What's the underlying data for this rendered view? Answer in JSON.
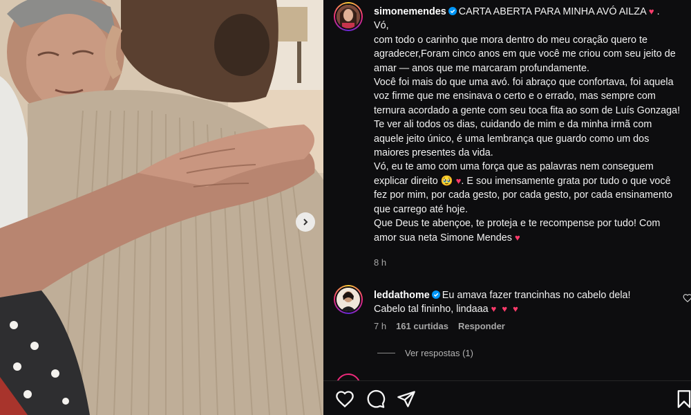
{
  "photo": {
    "alt_subject": "photo",
    "next_icon": "chevron-right-icon"
  },
  "post": {
    "username": "simonemendes",
    "verified": true,
    "caption": {
      "title": "CARTA ABERTA PARA MINHA AVÓ AILZA",
      "title_end": ".",
      "p1": "Vó,",
      "p2": "com todo o carinho que mora dentro do meu coração quero te agradecer,Foram cinco anos em que você me criou com seu jeito de amar — anos que me marcaram profundamente.",
      "p3": "Você foi mais do que uma avó. foi abraço que confortava, foi aquela voz firme que me ensinava o certo e o errado, mas sempre com ternura acordado a gente com seu toca fita ao som de Luís Gonzaga!",
      "p4": "Te ver ali todos os dias, cuidando de mim e da minha irmã com aquele jeito único, é uma lembrança que guardo como um dos maiores presentes da vida.",
      "p5a": "Vó, eu te amo com uma força que as palavras nem conseguem explicar direito",
      "p5b": ". E sou imensamente grata por tudo o que você fez por mim, por cada gesto, por cada gesto, por cada ensinamento que carrego até hoje.",
      "p6": "Que Deus te abençoe, te proteja e te recompense por tudo! Com amor sua neta Simone Mendes"
    },
    "time": "8 h"
  },
  "comment": {
    "username": "leddathome",
    "verified": true,
    "text": "Eu amava fazer trancinhas no cabelo dela! Cabelo tal fininho, lindaaa",
    "time": "7 h",
    "likes": "161 curtidas",
    "reply_label": "Responder",
    "view_replies": "Ver respostas (1)"
  },
  "icons": {
    "like": "heart-icon",
    "comment": "comment-icon",
    "share": "send-icon",
    "save": "bookmark-icon"
  },
  "colors": {
    "background": "#0d0d0f",
    "text": "#f2f2f2",
    "muted": "#a8a8a8",
    "verified": "#0095f6",
    "heart": "#ff3b6b"
  }
}
